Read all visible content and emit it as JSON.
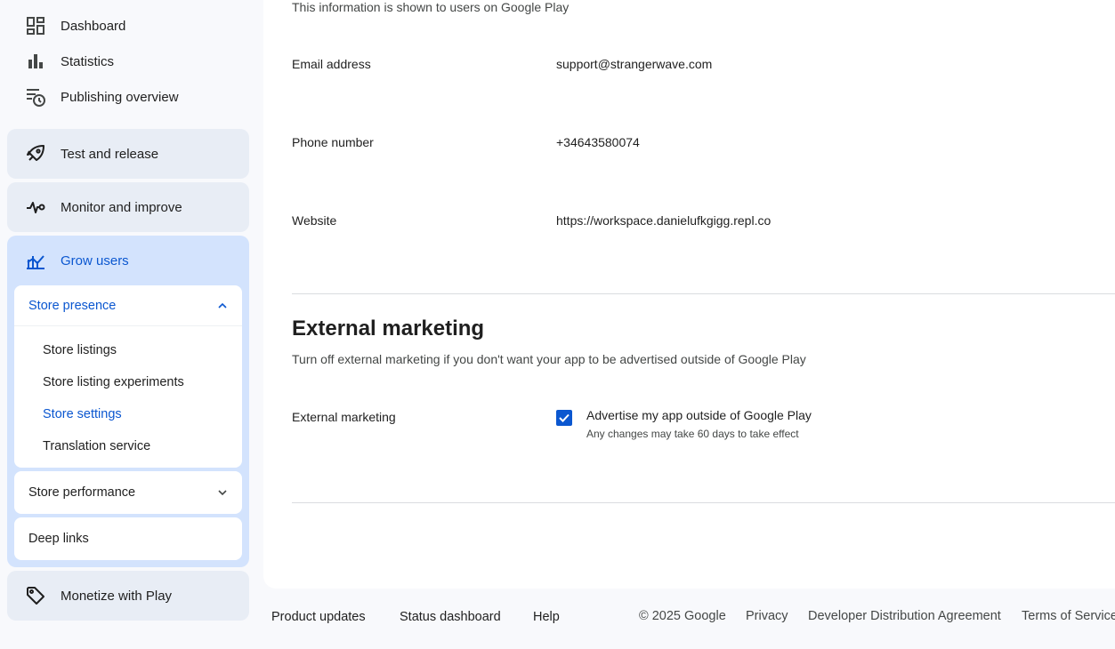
{
  "sidebar": {
    "top_items": [
      {
        "label": "Dashboard",
        "icon": "dashboard-icon"
      },
      {
        "label": "Statistics",
        "icon": "bar-chart-icon"
      },
      {
        "label": "Publishing overview",
        "icon": "publishing-clock-icon"
      }
    ],
    "sections": {
      "test_release": {
        "label": "Test and release",
        "icon": "rocket-icon"
      },
      "monitor": {
        "label": "Monitor and improve",
        "icon": "pulse-icon"
      },
      "grow": {
        "label": "Grow users",
        "icon": "growth-chart-icon"
      },
      "monetize": {
        "label": "Monetize with Play",
        "icon": "tag-icon"
      }
    },
    "store_presence": {
      "label": "Store presence",
      "items": [
        "Store listings",
        "Store listing experiments",
        "Store settings",
        "Translation service"
      ],
      "selected": "Store settings"
    },
    "store_performance": {
      "label": "Store performance"
    },
    "deep_links": {
      "label": "Deep links"
    }
  },
  "main": {
    "intro": "This information is shown to users on Google Play",
    "fields": {
      "email": {
        "label": "Email address",
        "value": "support@strangerwave.com"
      },
      "phone": {
        "label": "Phone number",
        "value": "+34643580074"
      },
      "website": {
        "label": "Website",
        "value": "https://workspace.danielufkgigg.repl.co"
      }
    },
    "external_marketing": {
      "title": "External marketing",
      "description": "Turn off external marketing if you don't want your app to be advertised outside of Google Play",
      "field_label": "External marketing",
      "checkbox_label": "Advertise my app outside of Google Play",
      "checkbox_hint": "Any changes may take 60 days to take effect",
      "checked": true
    }
  },
  "footer": {
    "links": [
      "Product updates",
      "Status dashboard",
      "Help"
    ],
    "copyright": "© 2025 Google",
    "right_links": [
      "Privacy",
      "Developer Distribution Agreement",
      "Terms of Service"
    ]
  },
  "colors": {
    "accent": "#0b57d0",
    "grow_bg": "#d3e3fd",
    "card_bg": "#e8edf5"
  }
}
